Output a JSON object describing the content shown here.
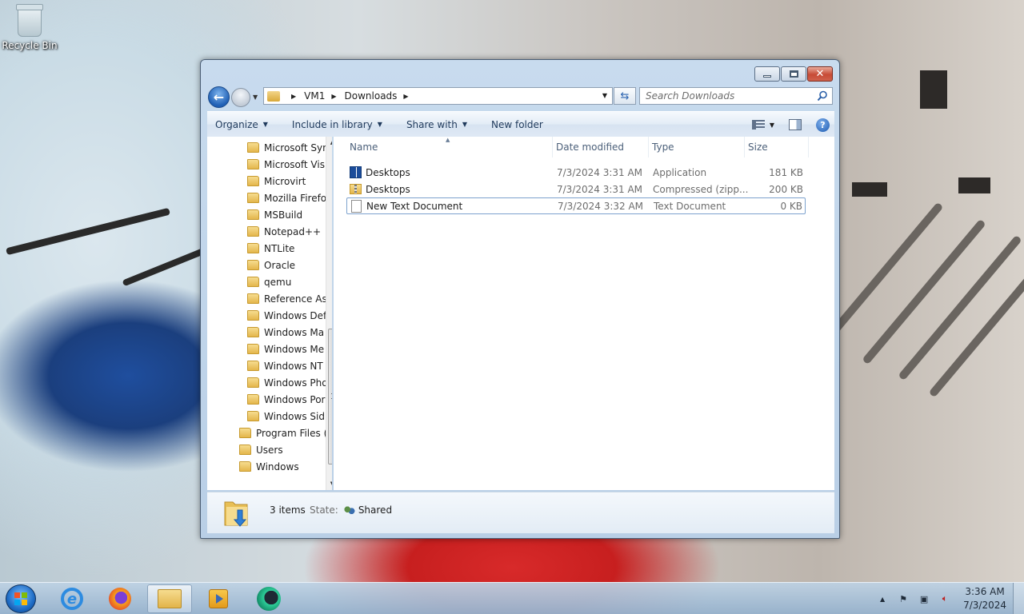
{
  "desktop": {
    "recycle_bin_label": "Recycle Bin"
  },
  "window": {
    "breadcrumb": [
      "VM1",
      "Downloads"
    ],
    "search_placeholder": "Search Downloads",
    "toolbar": {
      "organize": "Organize",
      "include_in_library": "Include in library",
      "share_with": "Share with",
      "new_folder": "New folder"
    },
    "nav_tree": [
      {
        "label": "Microsoft Syn",
        "level": 2
      },
      {
        "label": "Microsoft Vis",
        "level": 2
      },
      {
        "label": "Microvirt",
        "level": 2
      },
      {
        "label": "Mozilla Firefo",
        "level": 2
      },
      {
        "label": "MSBuild",
        "level": 2
      },
      {
        "label": "Notepad++",
        "level": 2
      },
      {
        "label": "NTLite",
        "level": 2
      },
      {
        "label": "Oracle",
        "level": 2
      },
      {
        "label": "qemu",
        "level": 2
      },
      {
        "label": "Reference As",
        "level": 2
      },
      {
        "label": "Windows Def",
        "level": 2
      },
      {
        "label": "Windows Ma",
        "level": 2
      },
      {
        "label": "Windows Me",
        "level": 2
      },
      {
        "label": "Windows NT",
        "level": 2
      },
      {
        "label": "Windows Pho",
        "level": 2
      },
      {
        "label": "Windows Por",
        "level": 2
      },
      {
        "label": "Windows Sid",
        "level": 2
      },
      {
        "label": "Program Files (",
        "level": 1
      },
      {
        "label": "Users",
        "level": 1
      },
      {
        "label": "Windows",
        "level": 1
      }
    ],
    "columns": {
      "name": "Name",
      "date_modified": "Date modified",
      "type": "Type",
      "size": "Size"
    },
    "files": [
      {
        "name": "Desktops",
        "date": "7/3/2024 3:31 AM",
        "type": "Application",
        "size": "181 KB",
        "icon": "application-icon"
      },
      {
        "name": "Desktops",
        "date": "7/3/2024 3:31 AM",
        "type": "Compressed (zipp...",
        "size": "200 KB",
        "icon": "zip-folder-icon"
      },
      {
        "name": "New Text Document",
        "date": "7/3/2024 3:32 AM",
        "type": "Text Document",
        "size": "0 KB",
        "icon": "text-file-icon"
      }
    ],
    "details": {
      "item_count": "3 items",
      "state_label": "State:",
      "state_value": "Shared"
    }
  },
  "taskbar": {
    "clock_time": "3:36 AM",
    "clock_date": "7/3/2024"
  }
}
